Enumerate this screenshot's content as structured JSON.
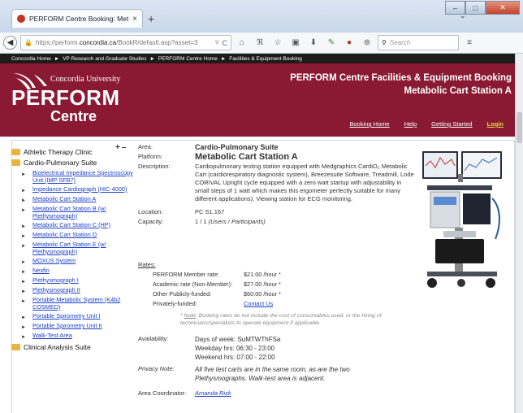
{
  "browser": {
    "tab_title": "PERFORM Centre Booking: Metab...",
    "tab_close": "×",
    "new_tab": "+",
    "url_prefix": "https://perform.",
    "url_domain": "concordia.ca",
    "url_path": "/BookR/default.asp?asset=3",
    "search_placeholder": "Search",
    "window_min": "–",
    "window_max": "□",
    "window_close": "✕"
  },
  "breadcrumb": [
    "Concordia Home",
    "VP Research and Graduate Studies",
    "PERFORM Centre Home",
    "Facilities & Equipment Booking"
  ],
  "breadcrumb_sep": "►",
  "banner": {
    "university": "Concordia University",
    "perform": "PERFORM",
    "centre": "Centre",
    "title_line1": "PERFORM Centre Facilities & Equipment Booking",
    "title_line2": "Metabolic Cart Station A",
    "nav": {
      "booking_home": "Booking Home",
      "help": "Help",
      "getting_started": "Getting Started",
      "login": "Login"
    },
    "brand_color": "#8a1a33"
  },
  "sidebar": {
    "expand": "+",
    "collapse": "–",
    "cat1": "Athletic Therapy Clinic",
    "cat2": "Cardio-Pulmonary Suite",
    "items": [
      "Bioelectrical Impedance Spectroscopy Unit (IMP SFB7)",
      "Impedance Cardiograph (HIC-4000)",
      "Metabolic Cart Station A",
      "Metabolic Cart Station B (w/ Plethysmograph)",
      "Metabolic Cart Station C (HP)",
      "Metabolic Cart Station D",
      "Metabolic Cart Station E (w/ Plethysmograph)",
      "MOXUS System",
      "Nexfin",
      "Plethysmograph I",
      "Plethysmograph II",
      "Portable Metabolic System (K4b2 COSMED)",
      "Portable Spirometry Unit I",
      "Portable Spirometry Unit II",
      "Walk-Test Area"
    ],
    "cat3": "Clinical Analysis Suite"
  },
  "details": {
    "area_label": "Area:",
    "area": "Cardio-Pulmonary Suite",
    "platform_label": "Platform:",
    "platform": "Metabolic Cart Station A",
    "description_label": "Description:",
    "description": "Cardiopulmonary testing station equipped with Medgraphics CardiO₂ Metabolic Cart (cardiorespiratory diagnostic system), Breezesuite Software, Treadmill, Lode CORIVAL Upright cycle equipped with a zero watt startup with adjustability in small steps of 1 watt which makes this ergometer perfectly suitable for many different applications). Viewing station for ECG monitoring.",
    "location_label": "Location:",
    "location": "PC S1.167",
    "capacity_label": "Capacity:",
    "capacity": "1 / 1",
    "capacity_unit": "(Users / Participants)",
    "rates_label": "Rates:",
    "rates": [
      {
        "label": "PERFORM Member rate:",
        "value": "$21.00 /hour *"
      },
      {
        "label": "Academic rate (Non-Member):",
        "value": "$27.00 /hour *"
      },
      {
        "label": "Other Publicly-funded:",
        "value": "$60.00 /hour *"
      }
    ],
    "private_label": "Privately-funded:",
    "contact_us": "Contact Us",
    "note_prefix": "* ",
    "note_word": "Note",
    "note": ": Booking rates do not include the cost of consumables used, or the hiring of technicians/specialists to operate equipment if applicable.",
    "availability_label": "Availability:",
    "days": "Days of week: SuMTWThFSa",
    "weekday": "Weekday hrs: 06:30 - 23:00",
    "weekend": "Weekend hrs: 07:00 - 22:00",
    "privacy_label": "Privacy Note:",
    "privacy": "All five test carts are in the same room, as are the two Plethysmographs. Walk-test area is adjacent.",
    "coordinator_label": "Area Coordinator:",
    "coordinator": "Amanda Rizk"
  }
}
